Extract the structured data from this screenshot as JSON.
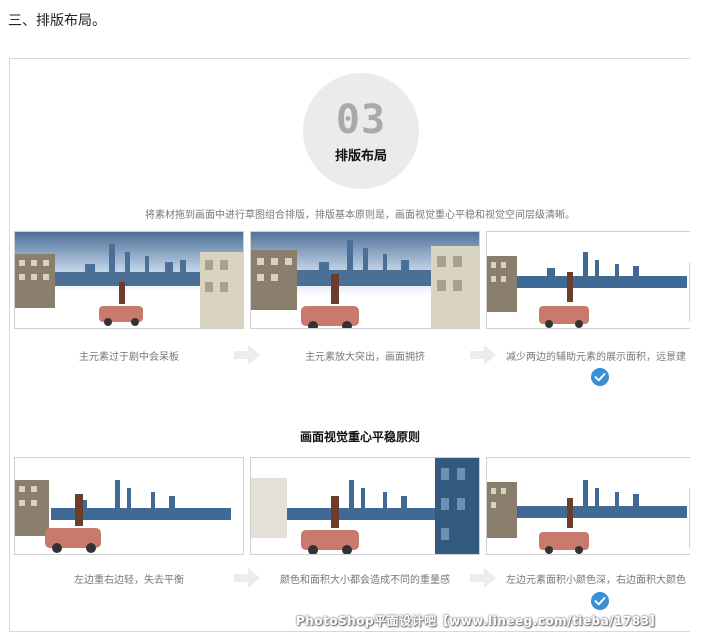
{
  "heading": "三、排版布局。",
  "badge": {
    "number": "03",
    "title": "排版布局"
  },
  "intro": "将素材拖到画面中进行草图组合排版，排版基本原则是，画面视觉重心平稳和视觉空间层级清晰。",
  "row1": {
    "captions": [
      "主元素过于剧中会呆板",
      "主元素放大突出，画面拥挤",
      "减少两边的辅助元素的展示面积，远景建"
    ]
  },
  "section_title": "画面视觉重心平稳原则",
  "row2": {
    "captions": [
      "左边重右边轻，失去平衡",
      "颜色和面积大小都会造成不同的重量感",
      "左边元素面积小颜色深，右边面积大颜色"
    ]
  },
  "watermark": "PhotoShop平面设计吧【www.lineeg.com/tieba/1783】",
  "colors": {
    "check": "#3b8fd4",
    "badge_bg": "#ebebeb",
    "sky": "#8fb3d9",
    "car": "#c97a6a"
  }
}
